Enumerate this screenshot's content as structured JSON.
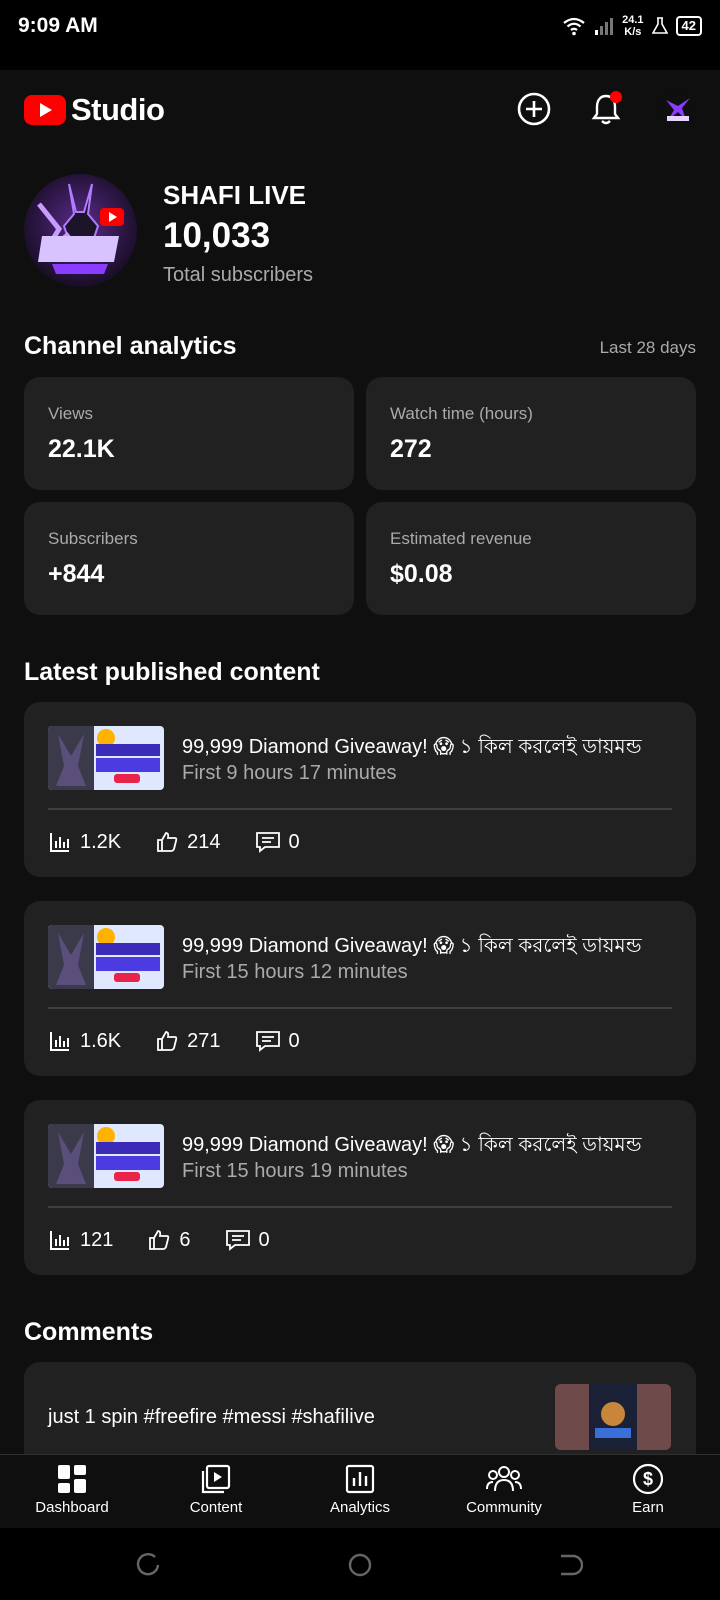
{
  "status_bar": {
    "time": "9:09 AM",
    "net_speed_value": "24.1",
    "net_speed_unit": "K/s",
    "battery": "42"
  },
  "header": {
    "logo_text": "Studio",
    "icons": [
      "create-icon",
      "notifications-icon",
      "account-avatar"
    ]
  },
  "channel": {
    "name": "SHAFI LIVE",
    "subscriber_count": "10,033",
    "subscriber_label": "Total subscribers"
  },
  "analytics": {
    "title": "Channel analytics",
    "period": "Last 28 days",
    "cards": [
      {
        "label": "Views",
        "value": "22.1K"
      },
      {
        "label": "Watch time (hours)",
        "value": "272"
      },
      {
        "label": "Subscribers",
        "value": "+844"
      },
      {
        "label": "Estimated revenue",
        "value": "$0.08"
      }
    ]
  },
  "latest": {
    "title": "Latest published content",
    "videos": [
      {
        "title": "99,999 Diamond Giveaway! 😱 ১ কিল করলেই ডায়মন্ড",
        "subtitle": "First 9 hours 17 minutes",
        "views": "1.2K",
        "likes": "214",
        "comments": "0"
      },
      {
        "title": "99,999 Diamond Giveaway! 😱 ১ কিল করলেই ডায়মন্ড",
        "subtitle": "First 15 hours 12 minutes",
        "views": "1.6K",
        "likes": "271",
        "comments": "0"
      },
      {
        "title": "99,999 Diamond Giveaway! 😱 ১ কিল করলেই ডায়মন্ড",
        "subtitle": "First 15 hours 19 minutes",
        "views": "121",
        "likes": "6",
        "comments": "0"
      }
    ]
  },
  "comments": {
    "title": "Comments",
    "items": [
      {
        "text": "just 1 spin #freefire #messi #shafilive"
      }
    ]
  },
  "bottom_nav": [
    {
      "label": "Dashboard",
      "icon": "dashboard-icon"
    },
    {
      "label": "Content",
      "icon": "content-icon"
    },
    {
      "label": "Analytics",
      "icon": "analytics-icon"
    },
    {
      "label": "Community",
      "icon": "community-icon"
    },
    {
      "label": "Earn",
      "icon": "earn-icon"
    }
  ],
  "colors": {
    "background": "#0f0f0f",
    "card": "#212121",
    "youtube_red": "#ff0000",
    "secondary_text": "#aaaaaa",
    "notification_dot": "#ff0000"
  }
}
